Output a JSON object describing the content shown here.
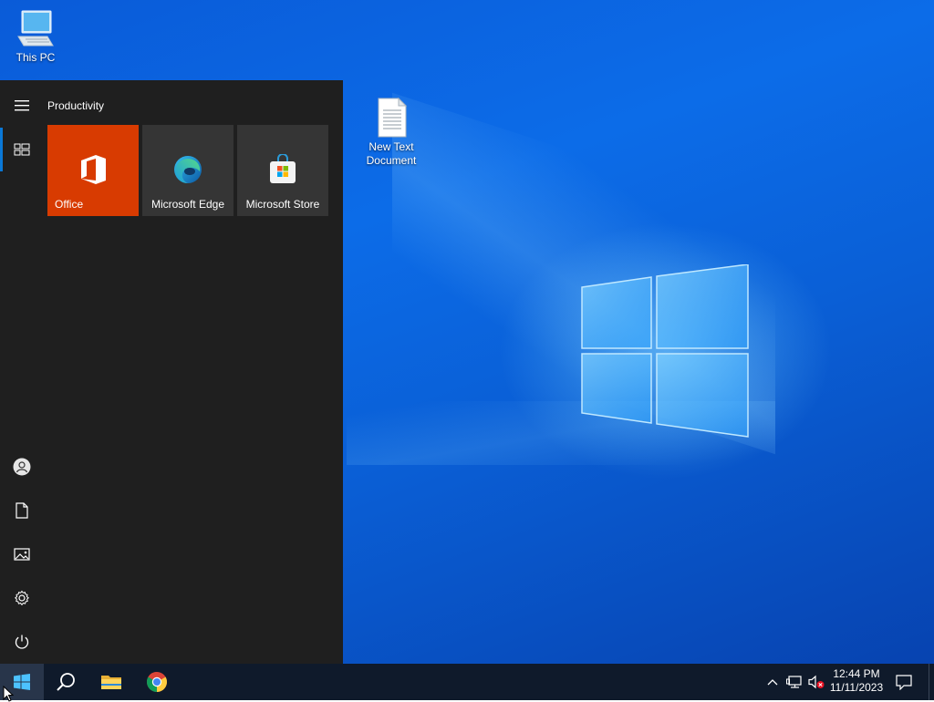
{
  "desktop": {
    "icons": [
      {
        "label": "This PC",
        "icon": "this-pc-icon"
      },
      {
        "label": "New Text Document",
        "icon": "text-document-icon"
      }
    ],
    "accent_color": "#0a78d7"
  },
  "start_menu": {
    "group_title": "Productivity",
    "tiles": [
      {
        "label": "Office",
        "icon": "office-icon",
        "color": "#d83b01"
      },
      {
        "label": "Microsoft Edge",
        "icon": "edge-icon",
        "color": "#353535"
      },
      {
        "label": "Microsoft Store",
        "icon": "store-icon",
        "color": "#353535"
      }
    ],
    "rail": [
      "hamburger-menu-icon",
      "all-apps-icon",
      "user-account-icon",
      "documents-icon",
      "pictures-icon",
      "settings-icon",
      "power-icon"
    ]
  },
  "taskbar": {
    "apps": [
      "start-icon",
      "search-icon",
      "file-explorer-icon",
      "chrome-icon"
    ],
    "tray": {
      "time": "12:44 PM",
      "date": "11/11/2023",
      "icons": [
        "chevron-up-icon",
        "network-icon",
        "volume-muted-icon",
        "notification-icon"
      ]
    }
  }
}
